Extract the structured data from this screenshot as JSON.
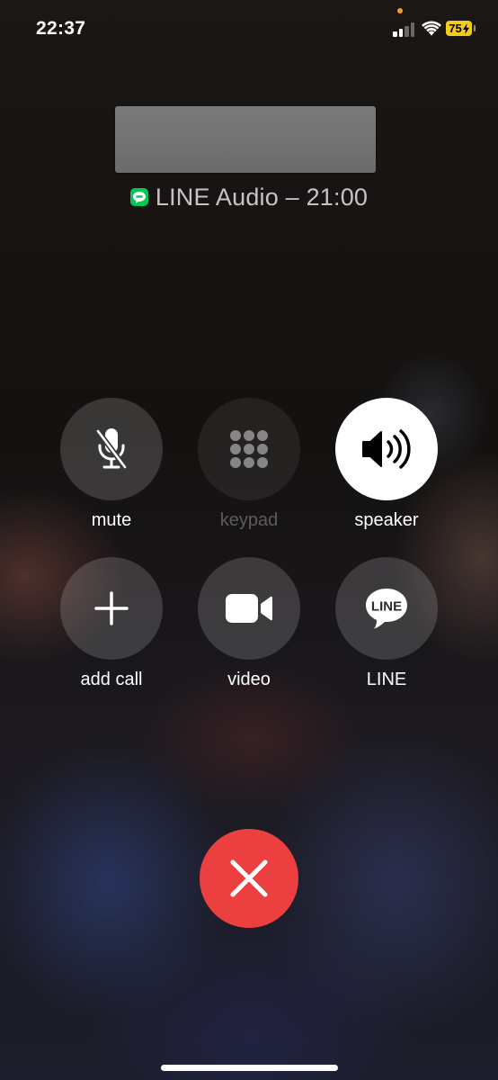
{
  "status_bar": {
    "time": "22:37",
    "battery_level": "75",
    "signal_bars_filled": 2,
    "signal_bars_total": 4,
    "icons": [
      "signal-icon",
      "wifi-icon",
      "battery-charging-icon"
    ]
  },
  "call": {
    "caller_name_redacted": true,
    "status_text": "LINE Audio – 21:00",
    "app_icon": "line-app-icon",
    "app_color": "#06c755"
  },
  "controls": [
    {
      "id": "mute",
      "label": "mute",
      "icon": "microphone-slash-icon",
      "active": false,
      "enabled": true
    },
    {
      "id": "keypad",
      "label": "keypad",
      "icon": "keypad-icon",
      "active": false,
      "enabled": false
    },
    {
      "id": "speaker",
      "label": "speaker",
      "icon": "speaker-icon",
      "active": true,
      "enabled": true
    },
    {
      "id": "add_call",
      "label": "add call",
      "icon": "plus-icon",
      "active": false,
      "enabled": true
    },
    {
      "id": "video",
      "label": "video",
      "icon": "video-camera-icon",
      "active": false,
      "enabled": true
    },
    {
      "id": "line",
      "label": "LINE",
      "icon": "line-logo-icon",
      "active": false,
      "enabled": true,
      "logo_text": "LINE"
    }
  ],
  "end_call": {
    "icon": "close-icon",
    "color": "#ec4040"
  },
  "colors": {
    "active_button": "#ffffff",
    "battery": "#f5cb1a",
    "privacy_dot": "#f29b30"
  }
}
